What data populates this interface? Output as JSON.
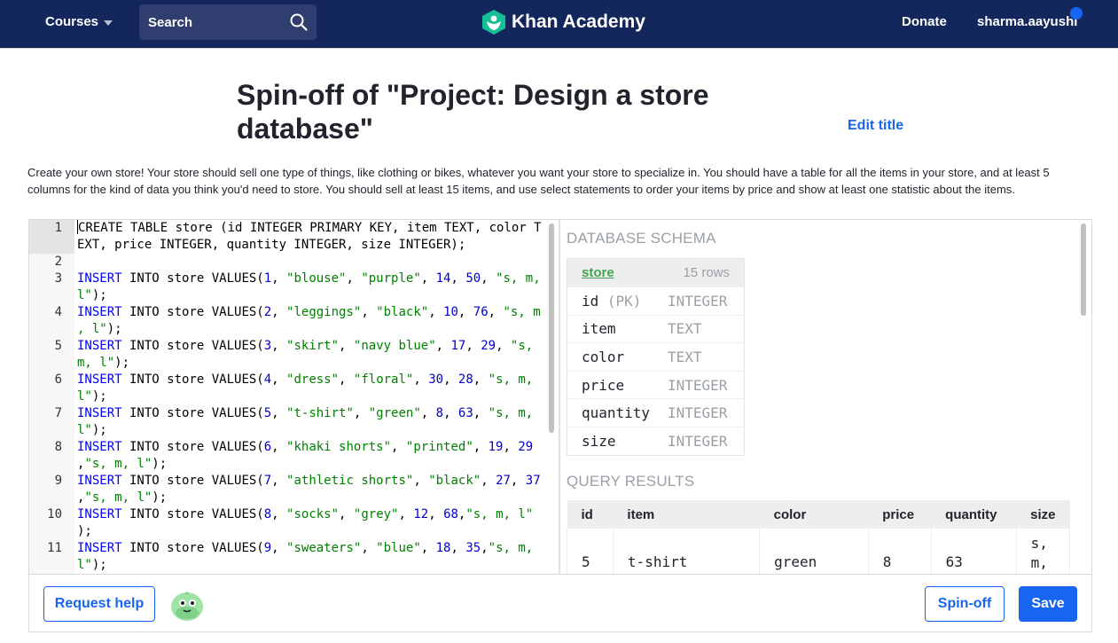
{
  "nav": {
    "courses": "Courses",
    "search_label": "Search",
    "logo_text": "Khan Academy",
    "donate": "Donate",
    "username": "sharma.aayushi"
  },
  "page": {
    "title": "Spin-off of \"Project: Design a store database\"",
    "edit_title": "Edit title",
    "description": "Create your own store! Your store should sell one type of things, like clothing or bikes, whatever you want your store to specialize in. You should have a table for all the items in your store, and at least 5 columns for the kind of data you think you'd need to store. You should sell at least 15 items, and use select statements to order your items by price and show at least one statistic about the items."
  },
  "editor": {
    "lines": [
      {
        "n": "1",
        "text": "CREATE TABLE store (id INTEGER PRIMARY KEY, item TEXT, color TEXT, price INTEGER, quantity INTEGER, size INTEGER);"
      },
      {
        "n": "2",
        "text": ""
      },
      {
        "n": "3",
        "text": "INSERT INTO store VALUES(1, \"blouse\", \"purple\", 14, 50, \"s, m, l\");"
      },
      {
        "n": "4",
        "text": "INSERT INTO store VALUES(2, \"leggings\", \"black\", 10, 76, \"s, m , l\");"
      },
      {
        "n": "5",
        "text": "INSERT INTO store VALUES(3, \"skirt\", \"navy blue\", 17, 29, \"s, m, l\");"
      },
      {
        "n": "6",
        "text": "INSERT INTO store VALUES(4, \"dress\", \"floral\", 30, 28, \"s, m, l\");"
      },
      {
        "n": "7",
        "text": "INSERT INTO store VALUES(5, \"t-shirt\", \"green\", 8, 63, \"s, m, l\");"
      },
      {
        "n": "8",
        "text": "INSERT INTO store VALUES(6, \"khaki shorts\", \"printed\", 19, 29 ,\"s, m, l\");"
      },
      {
        "n": "9",
        "text": "INSERT INTO store VALUES(7, \"athletic shorts\", \"black\", 27, 37 ,\"s, m, l\");"
      },
      {
        "n": "10",
        "text": "INSERT INTO store VALUES(8, \"socks\", \"grey\", 12, 68,\"s, m, l\" );"
      },
      {
        "n": "11",
        "text": "INSERT INTO store VALUES(9, \"sweaters\", \"blue\", 18, 35,\"s, m, l\");"
      }
    ]
  },
  "schema": {
    "heading": "DATABASE SCHEMA",
    "table_name": "store",
    "row_count": "15 rows",
    "columns": [
      {
        "name": "id",
        "pk": "(PK)",
        "type": "INTEGER"
      },
      {
        "name": "item",
        "pk": "",
        "type": "TEXT"
      },
      {
        "name": "color",
        "pk": "",
        "type": "TEXT"
      },
      {
        "name": "price",
        "pk": "",
        "type": "INTEGER"
      },
      {
        "name": "quantity",
        "pk": "",
        "type": "INTEGER"
      },
      {
        "name": "size",
        "pk": "",
        "type": "INTEGER"
      }
    ]
  },
  "results": {
    "heading": "QUERY RESULTS",
    "headers": [
      "id",
      "item",
      "color",
      "price",
      "quantity",
      "size"
    ],
    "rows": [
      [
        "5",
        "t-shirt",
        "green",
        "8",
        "63",
        "s,\nm,\nl"
      ]
    ]
  },
  "footer": {
    "request_help": "Request help",
    "spinoff": "Spin-off",
    "save": "Save"
  },
  "colors": {
    "nav_bg": "#14275d",
    "accent": "#1865f2",
    "keyword": "#0000ff",
    "string": "#008000",
    "table_link": "#41a44f"
  }
}
